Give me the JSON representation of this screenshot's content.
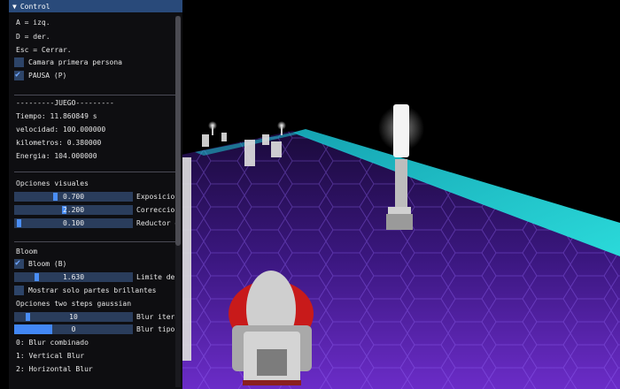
{
  "window": {
    "title": "Control",
    "collapse_icon": "triangle-down-icon"
  },
  "controls": {
    "line1": "A = izq.",
    "line2": "D = der.",
    "line3": "Esc = Cerrar."
  },
  "checkboxes": {
    "camera": {
      "label": "Camara primera persona",
      "checked": false
    },
    "pause": {
      "label": "PAUSA (P)",
      "checked": true
    }
  },
  "game": {
    "header": "---------JUEGO---------",
    "time": "Tiempo: 11.860849 s",
    "speed": "velocidad: 100.000000",
    "km": "kilometros: 0.380000",
    "energy": "Energia: 104.000000"
  },
  "visual": {
    "header": "Opciones visuales",
    "sliders": [
      {
        "label": "Exposicion",
        "value": "0.700",
        "fraction": 0.34
      },
      {
        "label": "Correccion",
        "value": "2.200",
        "fraction": 0.42
      },
      {
        "label": "Reductor de",
        "value": "0.100",
        "fraction": 0.02
      }
    ]
  },
  "bloom": {
    "header": "Bloom",
    "toggle": {
      "label": "Bloom (B)",
      "checked": true
    },
    "limit": {
      "label": "Limite de b",
      "value": "1.630",
      "fraction": 0.18
    },
    "bright_only": {
      "label": "Mostrar solo partes brillantes",
      "checked": false
    },
    "gauss_header": "Opciones two steps gaussian",
    "blur_iter": {
      "label": "Blur iterac",
      "value": "10",
      "fraction": 0.1
    },
    "blur_type": {
      "label": "Blur tipo",
      "value": "0",
      "fraction": 0.32
    },
    "mode0": "0: Blur combinado",
    "mode1": "1: Vertical Blur",
    "mode2": "2: Horizontal Blur"
  },
  "colors": {
    "accent": "#4287f5",
    "titlebar": "#294a7a",
    "track_edge": "#1ee6e6",
    "track_glow": "#7a2fd0",
    "car_red": "#d81e1e"
  }
}
